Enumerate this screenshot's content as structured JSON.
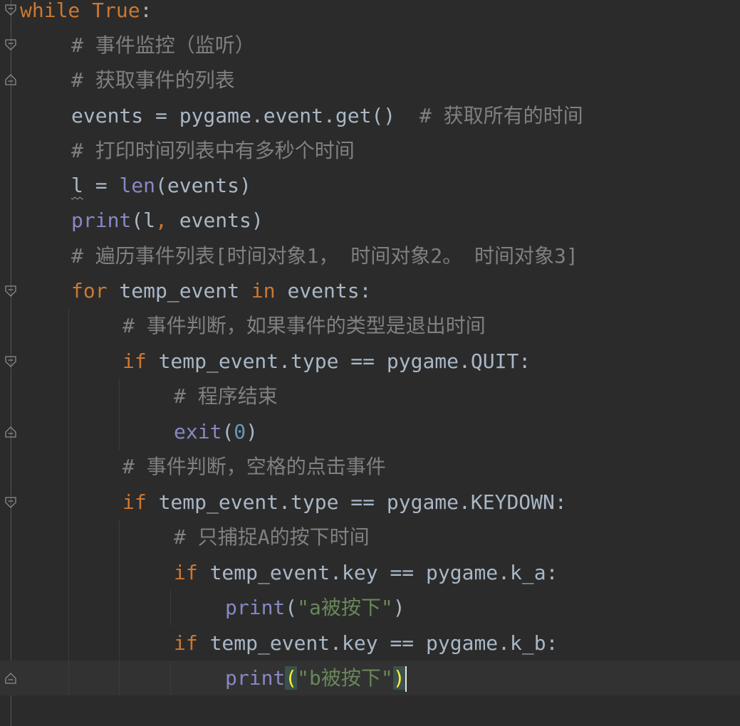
{
  "editor": {
    "language": "python",
    "colors": {
      "background": "#2b2b2b",
      "current_line": "#323232",
      "keyword": "#cc7832",
      "builtin": "#8888c6",
      "comment": "#808080",
      "string": "#6a8759",
      "number": "#6897bb",
      "identifier": "#a9b7c6",
      "bracket_match": "#ffef28"
    },
    "lines": [
      {
        "kw": "while",
        "sp": " ",
        "val": "True",
        "rest": ":"
      },
      {
        "comment": "# 事件监控（监听）"
      },
      {
        "comment": "# 获取事件的列表"
      },
      {
        "code": "events = pygame.event.get()",
        "sp": "  ",
        "comment": "# 获取所有的时间"
      },
      {
        "comment": "# 打印时间列表中有多秒个时间"
      },
      {
        "var": "l",
        "op": " = ",
        "fn": "len",
        "rest": "(events)"
      },
      {
        "fn": "print",
        "open": "(l",
        "comma": ",",
        "rest": " events)"
      },
      {
        "comment": "# 遍历事件列表[时间对象1， 时间对象2。 时间对象3]"
      },
      {
        "kw": "for",
        "mid": " temp_event ",
        "kw2": "in",
        "rest": " events:"
      },
      {
        "comment": "# 事件判断，如果事件的类型是退出时间"
      },
      {
        "kw": "if",
        "rest": " temp_event.type == pygame.QUIT:"
      },
      {
        "comment": "# 程序结束"
      },
      {
        "fn": "exit",
        "open": "(",
        "num": "0",
        "close": ")"
      },
      {
        "comment": "# 事件判断，空格的点击事件"
      },
      {
        "kw": "if",
        "rest": " temp_event.type == pygame.KEYDOWN:"
      },
      {
        "comment": "# 只捕捉A的按下时间"
      },
      {
        "kw": "if",
        "rest": " temp_event.key == pygame.k_a:"
      },
      {
        "fn": "print",
        "open": "(",
        "str": "\"a被按下\"",
        "close": ")"
      },
      {
        "kw": "if",
        "rest": " temp_event.key == pygame.k_b:"
      },
      {
        "fn": "print",
        "open": "(",
        "str": "\"b被按下\"",
        "close": ")"
      }
    ]
  }
}
